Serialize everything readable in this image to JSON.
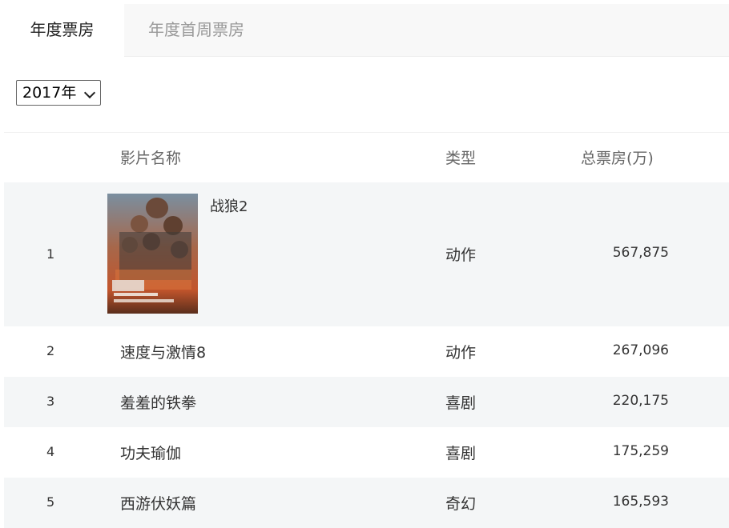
{
  "tabs": {
    "annual": "年度票房",
    "first_week": "年度首周票房"
  },
  "year_select": {
    "value": "2017年"
  },
  "table": {
    "headers": {
      "name": "影片名称",
      "type": "类型",
      "gross": "总票房(万)"
    },
    "rows": [
      {
        "rank": "1",
        "name": "战狼2",
        "type": "动作",
        "gross": "567,875"
      },
      {
        "rank": "2",
        "name": "速度与激情8",
        "type": "动作",
        "gross": "267,096"
      },
      {
        "rank": "3",
        "name": "羞羞的铁拳",
        "type": "喜剧",
        "gross": "220,175"
      },
      {
        "rank": "4",
        "name": "功夫瑜伽",
        "type": "喜剧",
        "gross": "175,259"
      },
      {
        "rank": "5",
        "name": "西游伏妖篇",
        "type": "奇幻",
        "gross": "165,593"
      }
    ]
  },
  "colors": {
    "alt_row": "#f4f6f7",
    "tab_bar": "#f8f8f8",
    "muted_text": "#999999"
  }
}
